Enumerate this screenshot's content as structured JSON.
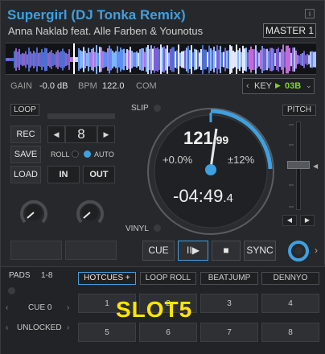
{
  "track": {
    "title": "Supergirl (DJ Tonka Remix)",
    "artist": "Anna Naklab feat. Alle Farben & Younotus"
  },
  "header": {
    "info_label": "i",
    "master_label": "MASTER 1"
  },
  "info": {
    "gain_label": "GAIN",
    "gain_value": "-0.0 dB",
    "bpm_label": "BPM",
    "bpm_value": "122.0",
    "com_label": "COM",
    "key_label": "KEY",
    "key_value": "03B"
  },
  "loop": {
    "label": "LOOP",
    "rec_label": "REC",
    "save_label": "SAVE",
    "load_label": "LOAD",
    "value": "8",
    "roll_label": "ROLL",
    "auto_label": "AUTO",
    "in_label": "IN",
    "out_label": "OUT"
  },
  "jog": {
    "slip_label": "SLIP",
    "vinyl_label": "VINYL",
    "bpm_main": "121",
    "bpm_decimal": ".99",
    "pitch_percent": "+0.0%",
    "pitch_range": "±12%",
    "time_main": "-04:49",
    "time_decimal": ".4"
  },
  "pitch": {
    "label": "PITCH"
  },
  "transport": {
    "cue_label": "CUE",
    "play_pause_label": "II▶",
    "stop_label": "■",
    "sync_label": "SYNC"
  },
  "pads": {
    "title": "PADS",
    "range": "1-8",
    "modes": [
      "HOTCUES +",
      "LOOP ROLL",
      "BEATJUMP",
      "DENNYO"
    ],
    "cue_label": "CUE 0",
    "lock_label": "UNLOCKED",
    "overlay_label": "SLOT5",
    "numbers": [
      "1",
      "2",
      "3",
      "4",
      "5",
      "6",
      "7",
      "8"
    ]
  },
  "colors": {
    "accent": "#3fa0e0",
    "key_green": "#7ed321",
    "overlay_yellow": "#ffe600"
  }
}
